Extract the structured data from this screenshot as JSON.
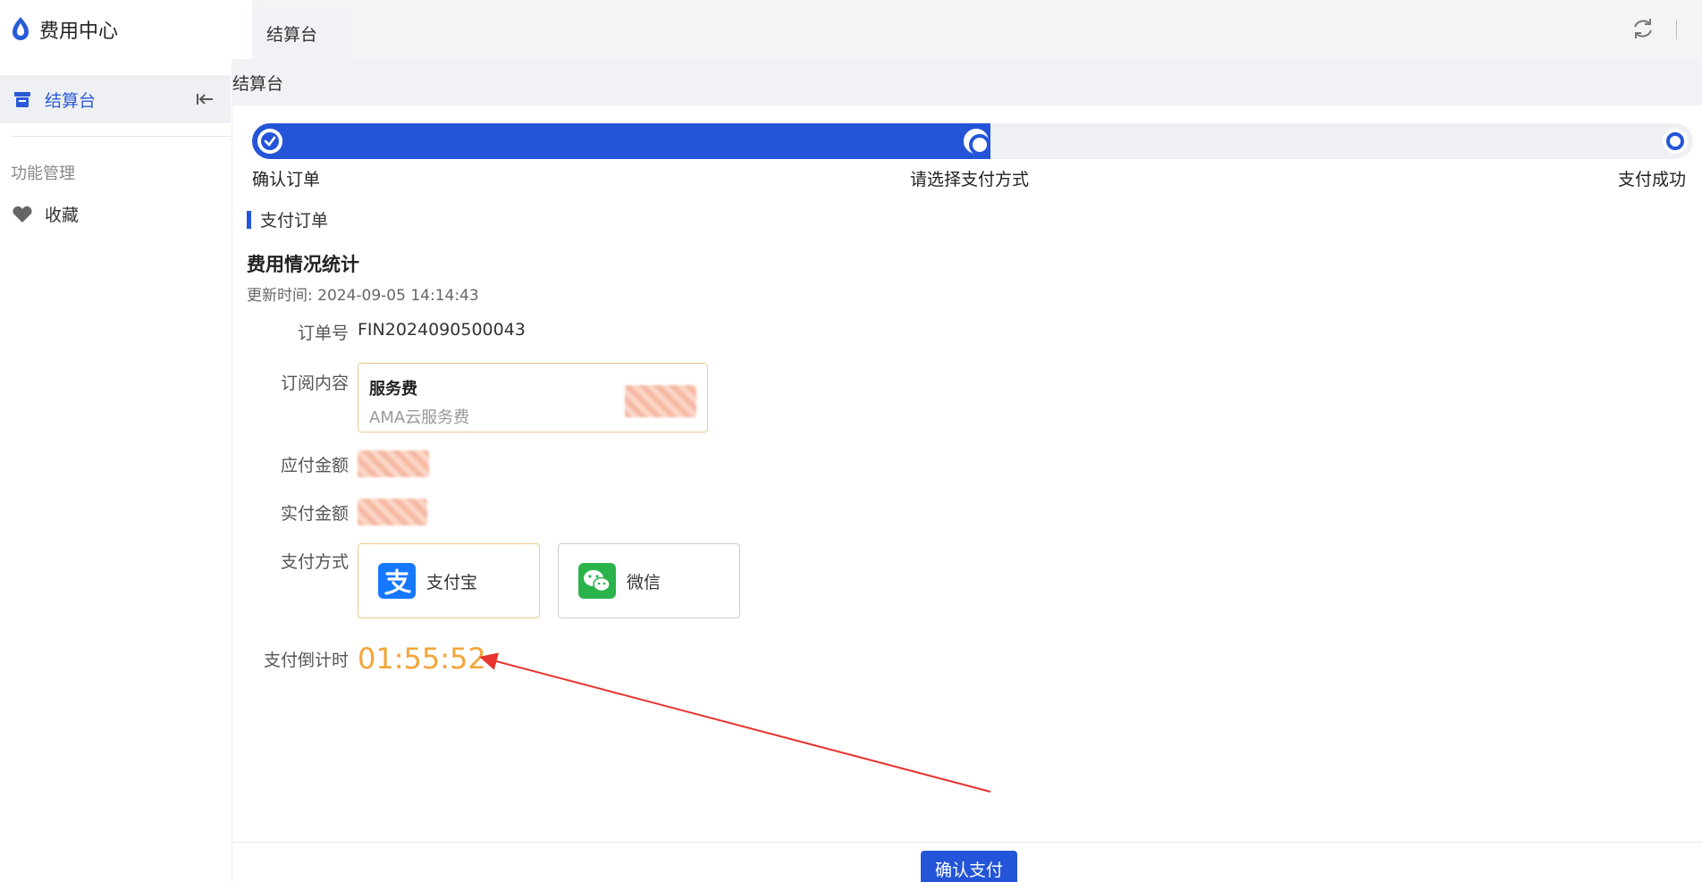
{
  "app": {
    "name": "费用中心"
  },
  "tabs": [
    {
      "label": "结算台"
    }
  ],
  "sidebar": {
    "active_item": "结算台",
    "group_title": "功能管理",
    "items": [
      {
        "label": "收藏"
      }
    ]
  },
  "breadcrumb": "结算台",
  "steps": [
    {
      "label": "确认订单",
      "state": "done"
    },
    {
      "label": "请选择支付方式",
      "state": "current"
    },
    {
      "label": "支付成功",
      "state": "pending"
    }
  ],
  "section": {
    "title": "支付订单",
    "stats_title": "费用情况统计",
    "updated": "更新时间: 2024-09-05 14:14:43"
  },
  "order": {
    "order_no_label": "订单号",
    "order_no": "FIN2024090500043",
    "subscription_label": "订阅内容",
    "subscription_name": "服务费",
    "subscription_desc": "AMA云服务费",
    "payable_label": "应付金额",
    "paid_label": "实付金额",
    "method_label": "支付方式",
    "methods": [
      {
        "label": "支付宝",
        "selected": true
      },
      {
        "label": "微信",
        "selected": false
      }
    ],
    "countdown_label": "支付倒计时",
    "countdown": "01:55:52"
  },
  "footer": {
    "confirm_label": "确认支付"
  },
  "colors": {
    "primary": "#2455d8",
    "countdown": "#f3a53a",
    "selected_border": "#f0c98a",
    "annotation": "#e8342e"
  }
}
